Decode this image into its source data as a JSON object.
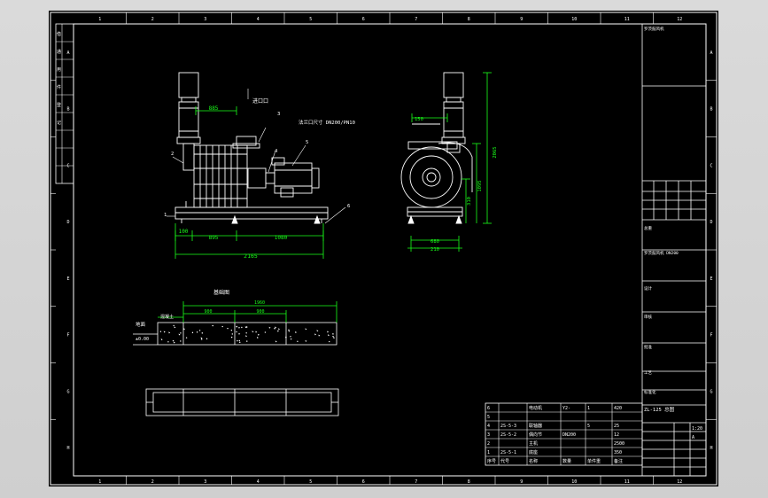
{
  "colors": {
    "background": "#000000",
    "frame": "#ffffff",
    "dimension": "#19ff19",
    "viewer": "#d7d7d7"
  },
  "zones": {
    "top": [
      "1",
      "2",
      "3",
      "4",
      "5",
      "6",
      "7",
      "8",
      "9",
      "10",
      "11",
      "12"
    ],
    "bottom": [
      "1",
      "2",
      "3",
      "4",
      "5",
      "6",
      "7",
      "8",
      "9",
      "10",
      "11",
      "12"
    ],
    "left": [
      "A",
      "B",
      "C",
      "D",
      "E",
      "F",
      "G",
      "H"
    ],
    "right": [
      "A",
      "B",
      "C",
      "D",
      "E",
      "F",
      "G",
      "H"
    ]
  },
  "front_view": {
    "dims": {
      "d885": "885",
      "d100": "100",
      "d895": "895",
      "d1080": "1080",
      "d2165": "2165"
    },
    "labels": {
      "inlet_note": "进口口",
      "outlet_note": "法兰口尺寸 DN200/PN10",
      "b1": "1",
      "b2": "2",
      "b3": "3",
      "b4": "4",
      "b5": "5",
      "b6": "6"
    }
  },
  "side_view": {
    "dims": {
      "d150": "150",
      "d2065": "2065",
      "d1095": "1095",
      "d310": "310",
      "d680": "680",
      "d210": "210"
    }
  },
  "foundation": {
    "title": "基础图",
    "labels": {
      "ground": "地面",
      "level": "±0.00",
      "grout": "混凝土",
      "top_dim": "1960",
      "seg1": "900",
      "seg2": "900"
    }
  },
  "bom": {
    "headers": [
      "序号",
      "代号",
      "名称",
      "数量",
      "单件重",
      "备注"
    ],
    "rows": [
      {
        "no": "6",
        "code": "",
        "name": "电动机",
        "qty": "1",
        "spec": "Y2-",
        "wt": "420"
      },
      {
        "no": "5",
        "code": "",
        "name": "",
        "qty": "",
        "spec": "",
        "wt": ""
      },
      {
        "no": "4",
        "code": "2S-5-3",
        "name": "联轴器",
        "qty": "5",
        "spec": "",
        "wt": "25"
      },
      {
        "no": "3",
        "code": "2S-5-2",
        "name": "偶向节",
        "qty": "",
        "spec": "DN200",
        "wt": "12"
      },
      {
        "no": "2",
        "code": "",
        "name": "主机",
        "qty": "",
        "spec": "",
        "wt": "2500"
      },
      {
        "no": "1",
        "code": "2S-5-1",
        "name": "底座",
        "qty": "",
        "spec": "",
        "wt": "350"
      }
    ]
  },
  "title_block": {
    "notes": [
      "罗茨鼓风机",
      "总重",
      "罗茨鼓风机 DN200",
      "设计",
      "审核",
      "批准",
      "工艺",
      "标准化"
    ],
    "drawing_no": "ZL-125 总图",
    "sheet": "1:20",
    "rev": "A"
  },
  "left_strip": {
    "labels": [
      "借",
      "通",
      "用",
      "件",
      "登",
      "记"
    ]
  }
}
